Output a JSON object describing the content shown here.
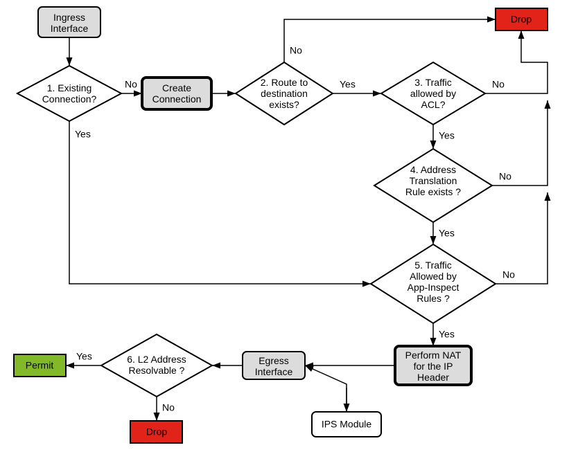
{
  "nodes": {
    "ingress": "Ingress Interface",
    "existing": "1. Existing Connection?",
    "create": "Create Connection",
    "route": "2. Route to destination exists?",
    "acl": "3. Traffic allowed by ACL?",
    "natrule": "4. Address Translation Rule exists ?",
    "appinsp": "5. Traffic Allowed by App-Inspect Rules ?",
    "nat": "Perform NAT for the IP Header",
    "ips": "IPS Module",
    "egress": "Egress Interface",
    "l2": "6. L2 Address Resolvable ?",
    "permit": "Permit",
    "drop1": "Drop",
    "drop2": "Drop"
  },
  "labels": {
    "yes": "Yes",
    "no": "No"
  },
  "chart_data": {
    "type": "diagram",
    "title": "",
    "flow": [
      {
        "from": "ingress",
        "to": "existing"
      },
      {
        "from": "existing",
        "to": "create",
        "label": "No"
      },
      {
        "from": "existing",
        "to": "appinsp",
        "label": "Yes"
      },
      {
        "from": "create",
        "to": "route"
      },
      {
        "from": "route",
        "to": "drop1",
        "label": "No"
      },
      {
        "from": "route",
        "to": "acl",
        "label": "Yes"
      },
      {
        "from": "acl",
        "to": "drop1",
        "label": "No"
      },
      {
        "from": "acl",
        "to": "natrule",
        "label": "Yes"
      },
      {
        "from": "natrule",
        "to": "drop1",
        "label": "No"
      },
      {
        "from": "natrule",
        "to": "appinsp",
        "label": "Yes"
      },
      {
        "from": "appinsp",
        "to": "drop1",
        "label": "No"
      },
      {
        "from": "appinsp",
        "to": "nat",
        "label": "Yes"
      },
      {
        "from": "nat",
        "to": "egress"
      },
      {
        "from": "egress",
        "to": "ips",
        "bidir": true
      },
      {
        "from": "egress",
        "to": "l2"
      },
      {
        "from": "l2",
        "to": "permit",
        "label": "Yes"
      },
      {
        "from": "l2",
        "to": "drop2",
        "label": "No"
      }
    ]
  }
}
